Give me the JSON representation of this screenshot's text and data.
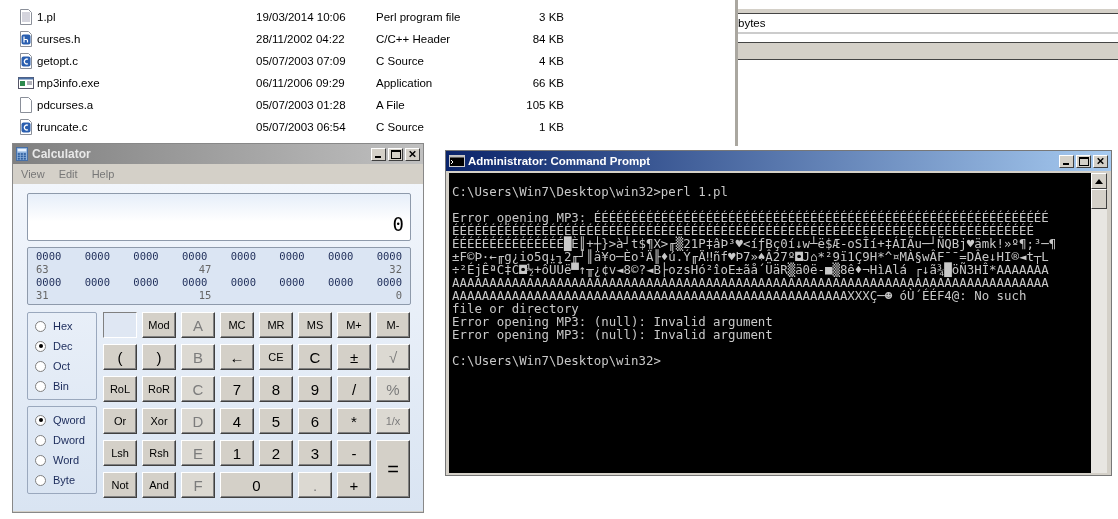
{
  "explorer": {
    "files": [
      {
        "name": "1.pl",
        "kind": "text",
        "date": "19/03/2014 10:06",
        "type": "Perl program file",
        "size": "3 KB"
      },
      {
        "name": "curses.h",
        "kind": "header",
        "date": "28/11/2002 04:22",
        "type": "C/C++ Header",
        "size": "84 KB"
      },
      {
        "name": "getopt.c",
        "kind": "source",
        "date": "05/07/2003 07:09",
        "type": "C Source",
        "size": "4 KB"
      },
      {
        "name": "mp3info.exe",
        "kind": "program",
        "date": "06/11/2006 09:29",
        "type": "Application",
        "size": "66 KB"
      },
      {
        "name": "pdcurses.a",
        "kind": "plain",
        "date": "05/07/2003 01:28",
        "type": "A File",
        "size": "105 KB"
      },
      {
        "name": "truncate.c",
        "kind": "source",
        "date": "05/07/2003 06:54",
        "type": "C Source",
        "size": "1 KB"
      }
    ],
    "side_panel": {
      "field_text": "bytes"
    }
  },
  "calculator": {
    "title": "Calculator",
    "menu": [
      "View",
      "Edit",
      "Help"
    ],
    "display": "0",
    "bit_rows": [
      {
        "groups": [
          "0000",
          "0000",
          "0000",
          "0000",
          "0000",
          "0000",
          "0000",
          "0000"
        ],
        "positions": [
          "63",
          "47",
          "32"
        ]
      },
      {
        "groups": [
          "0000",
          "0000",
          "0000",
          "0000",
          "0000",
          "0000",
          "0000",
          "0000"
        ],
        "positions": [
          "31",
          "15",
          "0"
        ]
      }
    ],
    "base_options": [
      {
        "label": "Hex",
        "selected": false
      },
      {
        "label": "Dec",
        "selected": true
      },
      {
        "label": "Oct",
        "selected": false
      },
      {
        "label": "Bin",
        "selected": false
      }
    ],
    "size_options": [
      {
        "label": "Qword",
        "selected": true
      },
      {
        "label": "Dword",
        "selected": false
      },
      {
        "label": "Word",
        "selected": false
      },
      {
        "label": "Byte",
        "selected": false
      }
    ],
    "keys": [
      {
        "kind": "blank"
      },
      {
        "kind": "key",
        "label": "Mod",
        "disabled": false
      },
      {
        "kind": "key",
        "label": "A",
        "disabled": true
      },
      {
        "kind": "key",
        "label": "MC",
        "disabled": false
      },
      {
        "kind": "key",
        "label": "MR",
        "disabled": false
      },
      {
        "kind": "key",
        "label": "MS",
        "disabled": false
      },
      {
        "kind": "key",
        "label": "M+",
        "disabled": false
      },
      {
        "kind": "key",
        "label": "M-",
        "disabled": false
      },
      {
        "kind": "key",
        "label": "(",
        "disabled": false
      },
      {
        "kind": "key",
        "label": ")",
        "disabled": false
      },
      {
        "kind": "key",
        "label": "B",
        "disabled": true
      },
      {
        "kind": "key",
        "label": "←",
        "disabled": false
      },
      {
        "kind": "key",
        "label": "CE",
        "disabled": false
      },
      {
        "kind": "key",
        "label": "C",
        "disabled": false
      },
      {
        "kind": "key",
        "label": "±",
        "disabled": false
      },
      {
        "kind": "key",
        "label": "√",
        "disabled": true
      },
      {
        "kind": "key",
        "label": "RoL",
        "disabled": false
      },
      {
        "kind": "key",
        "label": "RoR",
        "disabled": false
      },
      {
        "kind": "key",
        "label": "C",
        "disabled": true
      },
      {
        "kind": "key",
        "label": "7",
        "disabled": false
      },
      {
        "kind": "key",
        "label": "8",
        "disabled": false
      },
      {
        "kind": "key",
        "label": "9",
        "disabled": false
      },
      {
        "kind": "key",
        "label": "/",
        "disabled": false
      },
      {
        "kind": "key",
        "label": "%",
        "disabled": true
      },
      {
        "kind": "key",
        "label": "Or",
        "disabled": false
      },
      {
        "kind": "key",
        "label": "Xor",
        "disabled": false
      },
      {
        "kind": "key",
        "label": "D",
        "disabled": true
      },
      {
        "kind": "key",
        "label": "4",
        "disabled": false
      },
      {
        "kind": "key",
        "label": "5",
        "disabled": false
      },
      {
        "kind": "key",
        "label": "6",
        "disabled": false
      },
      {
        "kind": "key",
        "label": "*",
        "disabled": false
      },
      {
        "kind": "key",
        "label": "1/x",
        "disabled": true
      },
      {
        "kind": "key",
        "label": "Lsh",
        "disabled": false
      },
      {
        "kind": "key",
        "label": "Rsh",
        "disabled": false
      },
      {
        "kind": "key",
        "label": "E",
        "disabled": true
      },
      {
        "kind": "key",
        "label": "1",
        "disabled": false
      },
      {
        "kind": "key",
        "label": "2",
        "disabled": false
      },
      {
        "kind": "key",
        "label": "3",
        "disabled": false
      },
      {
        "kind": "key",
        "label": "-",
        "disabled": false
      },
      {
        "kind": "tall",
        "label": "=",
        "disabled": false
      },
      {
        "kind": "key",
        "label": "Not",
        "disabled": false
      },
      {
        "kind": "key",
        "label": "And",
        "disabled": false
      },
      {
        "kind": "key",
        "label": "F",
        "disabled": true
      },
      {
        "kind": "wide",
        "label": "0",
        "disabled": false
      },
      {
        "kind": "key",
        "label": ".",
        "disabled": true
      },
      {
        "kind": "key",
        "label": "+",
        "disabled": false
      }
    ]
  },
  "console": {
    "title": "Administrator: Command Prompt",
    "blocks": [
      [
        "C:\\Users\\Win7\\Desktop\\win32>perl 1.pl"
      ],
      [
        "Error opening MP3: ÉÉÉÉÉÉÉÉÉÉÉÉÉÉÉÉÉÉÉÉÉÉÉÉÉÉÉÉÉÉÉÉÉÉÉÉÉÉÉÉÉÉÉÉÉÉÉÉÉÉÉÉÉÉÉÉÉÉÉÉÉ",
        "ÉÉÉÉÉÉÉÉÉÉÉÉÉÉÉÉÉÉÉÉÉÉÉÉÉÉÉÉÉÉÉÉÉÉÉÉÉÉÉÉÉÉÉÉÉÉÉÉÉÉÉÉÉÉÉÉÉÉÉÉÉÉÉÉÉÉÉÉÉÉÉÉÉÉÉÉÉÉ",
        "ÉÉÉÉÉÉÉÉÉÉÉÉÉÉÉ█È║+┼}>à┘t$¶X>╓▒21P‡âÞ³♥<íƒBç0í↓w┴ë$Æ-oSÎí+‡ÁIÃu─┘ÑQBj♥ämk!»º¶;³─¶",
        "±F©Þ·←╓g¿io5q↓┐2╓┘║ä¥o─Èo¹Ä╟♦ú.Ý╓Ä‼ñf♥Þ7»♠Â27º◘J⌂*²9ï1Ç9H*^¤MÀ§wÂF¯¯=DÂe↓HI®◄t┬L",
        "÷²ÉjÊªC‡C◘½+ôÜÜë▀↑╥¿¢v◄8©?◄B├ozsHó²îoE±ãå´ÜäR▒ä0ë-■▒8ê♦¬HìAlá ┌↓ã¾█öÑ3HÎ*AAAAAAA",
        "AAAAAAAAAAAAAAAAAAAAAAAAAAAAAAAAAAAAAAAAAAAAAAAAAAAAAAAAAAAAAAAAAAAAAAAAAAAAAAAA",
        "AAAAAAAAAAAAAAAAAAAAAAAAAAAAAAAAAAAAAAAAAAAAAAAAAAAAAXXXÇ─☻ óÙ´ÉÉF4@: No such",
        "file or directory",
        "Error opening MP3: (null): Invalid argument",
        "Error opening MP3: (null): Invalid argument"
      ],
      [
        "C:\\Users\\Win7\\Desktop\\win32>"
      ]
    ]
  }
}
